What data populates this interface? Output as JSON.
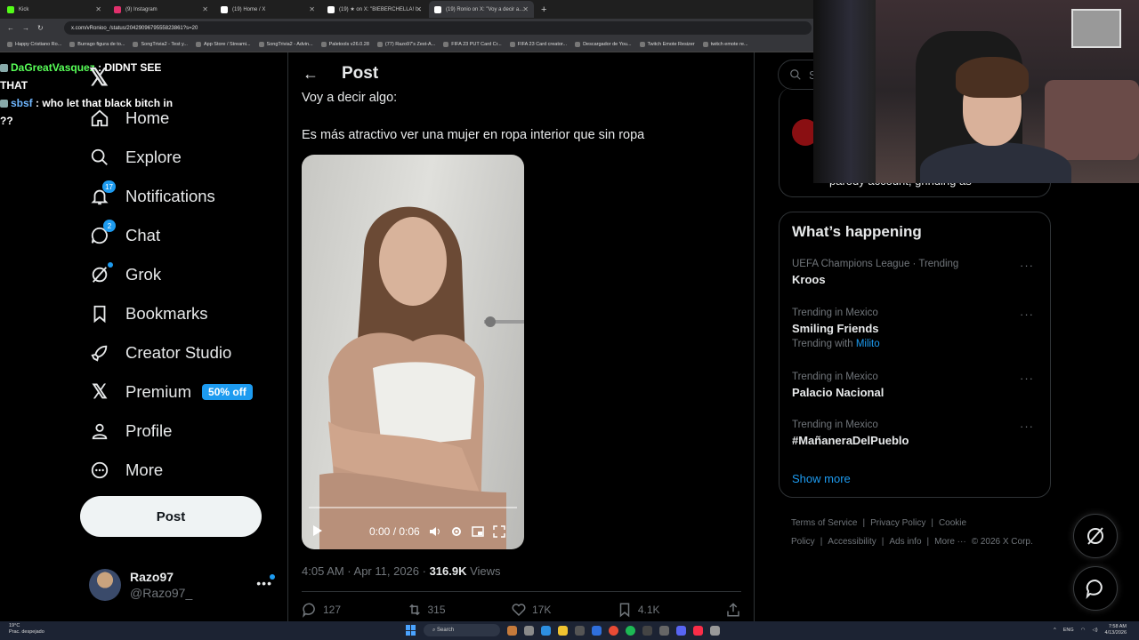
{
  "browser": {
    "tabs": [
      {
        "title": "Kick",
        "color": "#53fc18",
        "active": false
      },
      {
        "title": "(9) Instagram",
        "color": "#e1306c",
        "active": false
      },
      {
        "title": "(19) Home / X",
        "color": "#ffffff",
        "active": false
      },
      {
        "title": "(19) ★ on X: \"BIEBERCHELLA! I...",
        "color": "#ffffff",
        "active": false
      },
      {
        "title": "(19) Ronio on X: \"Voy a decir a...",
        "color": "#ffffff",
        "active": true
      }
    ],
    "url": "x.com/vRonioo_/status/2042909679555823861?s=20",
    "bookmarks": [
      "Happy Cristiano Ro...",
      "Burrago figura de to...",
      "SongTrivia2 - Test y...",
      "App Store / Streami...",
      "SongTrivia2 - Advin...",
      "Paletools v26.0.28",
      "(77) Razo97's Zest-A...",
      "FIFA 23 PUT Card Cr...",
      "FIFA 23 Card creator...",
      "Descargador de You...",
      "Twitch Emote Resizer",
      "twitch emote re..."
    ]
  },
  "chat": [
    {
      "user": "DaGreatVasquez",
      "message": ": DIDNT SEE THAT"
    },
    {
      "user": "sbsf",
      "message": ": who let that black bitch in ??"
    }
  ],
  "sidebar": {
    "items": [
      {
        "label": "Home",
        "icon": "home-icon"
      },
      {
        "label": "Explore",
        "icon": "search-icon"
      },
      {
        "label": "Notifications",
        "icon": "bell-icon",
        "badge": "17"
      },
      {
        "label": "Chat",
        "icon": "chat-icon",
        "badge": "2"
      },
      {
        "label": "Grok",
        "icon": "grok-icon",
        "dot": true
      },
      {
        "label": "Bookmarks",
        "icon": "bookmark-icon"
      },
      {
        "label": "Creator Studio",
        "icon": "rocket-icon"
      },
      {
        "label": "Premium",
        "icon": "x-logo-icon",
        "promo": "50% off"
      },
      {
        "label": "Profile",
        "icon": "person-icon"
      },
      {
        "label": "More",
        "icon": "more-circle-icon"
      }
    ],
    "post_label": "Post",
    "account": {
      "name": "Razo97",
      "handle": "@Razo97_"
    }
  },
  "main": {
    "title": "Post",
    "line1": "Voy a decir algo:",
    "line2": "Es más atractivo ver una mujer en ropa interior que sin ropa",
    "video": {
      "time": "0:00 / 0:06",
      "progress": 0.0
    },
    "timestamp": "4:05 AM · Apr 11, 2026 · ",
    "views_count": "316.9K",
    "views_label": " Views",
    "actions": {
      "replies": "127",
      "reposts": "315",
      "likes": "17K",
      "bookmarks": "4.1K"
    }
  },
  "right": {
    "search_placeholder": "Se",
    "premium_text": "parody account, grinding as",
    "trends_title": "What’s happening",
    "trends": [
      {
        "context": "UEFA Champions League · Trending",
        "name": "Kroos"
      },
      {
        "context": "Trending in Mexico",
        "name": "Smiling Friends",
        "with_prefix": "Trending with ",
        "with": "Milito"
      },
      {
        "context": "Trending in Mexico",
        "name": "Palacio Nacional"
      },
      {
        "context": "Trending in Mexico",
        "name": "#MañaneraDelPueblo"
      }
    ],
    "show_more": "Show more",
    "footer": [
      "Terms of Service",
      "|",
      "Privacy Policy",
      "|",
      "Cookie Policy",
      "|",
      "Accessibility",
      "|",
      "Ads info",
      "|",
      "More ···",
      "© 2026 X Corp."
    ]
  },
  "taskbar": {
    "weather_temp": "19°C",
    "weather_desc": "Prac. despejado",
    "search": "Search",
    "lang": "ENG",
    "time": "7:58 AM",
    "date": "4/13/2026"
  },
  "colors": {
    "accent": "#1d9bf0",
    "background": "#000000",
    "text": "#e7e9ea",
    "muted": "#71767b"
  }
}
